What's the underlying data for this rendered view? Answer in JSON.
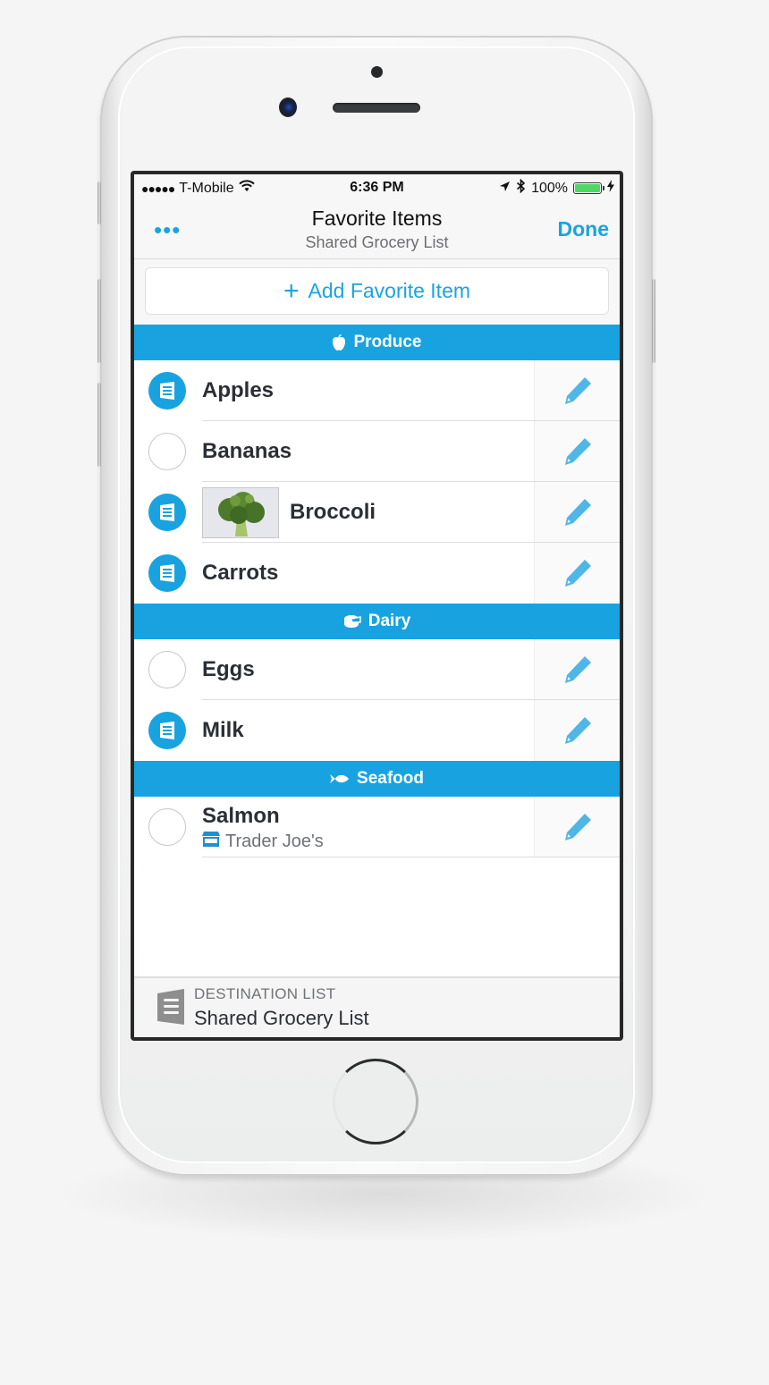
{
  "status_bar": {
    "signal": "●●●●●",
    "carrier": "T-Mobile",
    "time": "6:36 PM",
    "battery": "100%",
    "battery_fill": 1.0
  },
  "nav": {
    "more_label": "•••",
    "title": "Favorite Items",
    "subtitle": "Shared Grocery List",
    "done_label": "Done"
  },
  "add_button": {
    "plus": "+",
    "label": "Add Favorite Item"
  },
  "sections": [
    {
      "name": "Produce",
      "icon": "apple-icon",
      "items": [
        {
          "name": "Apples",
          "in_list": true
        },
        {
          "name": "Bananas",
          "in_list": false
        },
        {
          "name": "Broccoli",
          "in_list": true,
          "has_photo": true
        },
        {
          "name": "Carrots",
          "in_list": true
        }
      ]
    },
    {
      "name": "Dairy",
      "icon": "cheese-icon",
      "items": [
        {
          "name": "Eggs",
          "in_list": false
        },
        {
          "name": "Milk",
          "in_list": true
        }
      ]
    },
    {
      "name": "Seafood",
      "icon": "fish-icon",
      "items": [
        {
          "name": "Salmon",
          "in_list": false,
          "store": "Trader Joe's"
        }
      ]
    }
  ],
  "footer": {
    "label": "DESTINATION LIST",
    "value": "Shared Grocery List"
  },
  "colors": {
    "accent": "#18a3e0",
    "text": "#2a2f36",
    "battery": "#4cd964"
  }
}
